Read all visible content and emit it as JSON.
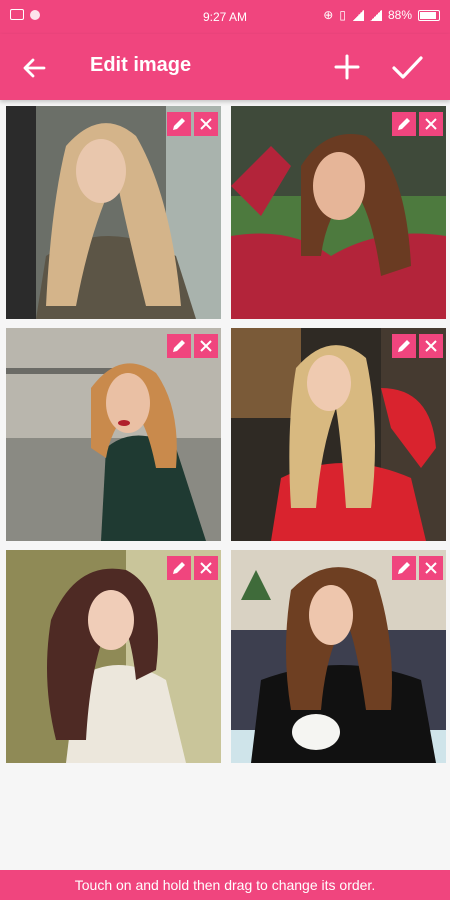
{
  "status_bar": {
    "time": "9:27 AM",
    "battery": "88%"
  },
  "app_bar": {
    "title": "Edit image"
  },
  "colors": {
    "accent": "#f0457e"
  },
  "photos": [
    {
      "name": "photo-1"
    },
    {
      "name": "photo-2"
    },
    {
      "name": "photo-3"
    },
    {
      "name": "photo-4"
    },
    {
      "name": "photo-5"
    },
    {
      "name": "photo-6"
    }
  ],
  "footer": {
    "hint": "Touch on and hold then drag to change its order."
  }
}
